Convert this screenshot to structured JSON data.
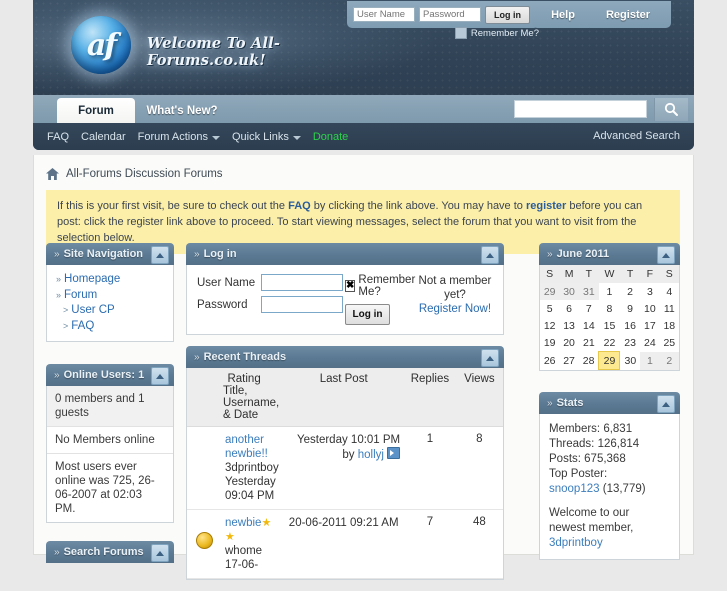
{
  "header": {
    "logo_text": "Welcome To All-Forums.co.uk!",
    "logo_mark": "af",
    "login": {
      "username_placeholder": "User Name",
      "password_placeholder": "Password",
      "username_value": "",
      "password_value": "",
      "login_label": "Log in",
      "remember_label": "Remember Me?"
    },
    "help_label": "Help",
    "register_label": "Register",
    "tabs": [
      {
        "label": "Forum",
        "active": true
      },
      {
        "label": "What's New?",
        "active": false
      }
    ],
    "search_value": "",
    "navlinks": [
      {
        "label": "FAQ",
        "caret": false,
        "donate": false
      },
      {
        "label": "Calendar",
        "caret": false,
        "donate": false
      },
      {
        "label": "Forum Actions",
        "caret": true,
        "donate": false
      },
      {
        "label": "Quick Links",
        "caret": true,
        "donate": false
      },
      {
        "label": "Donate",
        "caret": false,
        "donate": true
      }
    ],
    "advanced_search": "Advanced Search"
  },
  "breadcrumb": "All-Forums Discussion Forums",
  "notice": {
    "part1": "If this is your first visit, be sure to check out the ",
    "faq": "FAQ",
    "part2": " by clicking the link above. You may have to ",
    "register": "register",
    "part3": " before you can post: click the register link above to proceed. To start viewing messages, select the forum that you want to visit from the selection below."
  },
  "site_navigation": {
    "title": "Site Navigation",
    "items": [
      {
        "label": "Homepage",
        "marker": "»",
        "sub": false
      },
      {
        "label": "Forum",
        "marker": "»",
        "sub": false
      },
      {
        "label": "User CP",
        "marker": ">",
        "sub": true
      },
      {
        "label": "FAQ",
        "marker": ">",
        "sub": true
      }
    ]
  },
  "online_users": {
    "title": "Online Users: 1",
    "rows": [
      "0 members and 1 guests",
      "No Members online",
      "Most users ever online was 725, 26-06-2007 at 02:03 PM."
    ]
  },
  "search_forums": {
    "title": "Search Forums"
  },
  "login_block": {
    "title": "Log in",
    "username_label": "User Name",
    "password_label": "Password",
    "username_value": "",
    "password_value": "",
    "remember_label": "Remember Me?",
    "remember_checked": "✖",
    "login_label": "Log in",
    "not_member": "Not a member yet?",
    "register_now": "Register Now!"
  },
  "recent_threads": {
    "title": "Recent Threads",
    "columns": {
      "rating": "Rating",
      "title": "Title, Username, & Date",
      "last_post": "Last Post",
      "replies": "Replies",
      "views": "Views"
    },
    "rows": [
      {
        "icon": "",
        "title": "another newbie!!",
        "username": "3dprintboy",
        "date": "Yesterday 09:04 PM",
        "last_post_date": "Yesterday 10:01 PM",
        "last_post_by_prefix": "by",
        "last_post_by": "hollyj",
        "replies": "1",
        "views": "8",
        "stars": ""
      },
      {
        "icon": "coin",
        "title": "newbie",
        "username": "whome",
        "date": "17-06-",
        "last_post_date": "20-06-2011 09:21 AM",
        "last_post_by_prefix": "",
        "last_post_by": "",
        "replies": "7",
        "views": "48",
        "stars": "★ ★"
      }
    ]
  },
  "calendar": {
    "title": "June 2011",
    "daynames": [
      "S",
      "M",
      "T",
      "W",
      "T",
      "F",
      "S"
    ],
    "weeks": [
      [
        {
          "d": "29",
          "c": "off"
        },
        {
          "d": "30",
          "c": "off"
        },
        {
          "d": "31",
          "c": "off"
        },
        {
          "d": "1",
          "c": ""
        },
        {
          "d": "2",
          "c": ""
        },
        {
          "d": "3",
          "c": ""
        },
        {
          "d": "4",
          "c": ""
        }
      ],
      [
        {
          "d": "5",
          "c": ""
        },
        {
          "d": "6",
          "c": ""
        },
        {
          "d": "7",
          "c": ""
        },
        {
          "d": "8",
          "c": ""
        },
        {
          "d": "9",
          "c": ""
        },
        {
          "d": "10",
          "c": ""
        },
        {
          "d": "11",
          "c": ""
        }
      ],
      [
        {
          "d": "12",
          "c": ""
        },
        {
          "d": "13",
          "c": ""
        },
        {
          "d": "14",
          "c": ""
        },
        {
          "d": "15",
          "c": ""
        },
        {
          "d": "16",
          "c": ""
        },
        {
          "d": "17",
          "c": ""
        },
        {
          "d": "18",
          "c": ""
        }
      ],
      [
        {
          "d": "19",
          "c": ""
        },
        {
          "d": "20",
          "c": ""
        },
        {
          "d": "21",
          "c": ""
        },
        {
          "d": "22",
          "c": ""
        },
        {
          "d": "23",
          "c": ""
        },
        {
          "d": "24",
          "c": ""
        },
        {
          "d": "25",
          "c": ""
        }
      ],
      [
        {
          "d": "26",
          "c": ""
        },
        {
          "d": "27",
          "c": ""
        },
        {
          "d": "28",
          "c": ""
        },
        {
          "d": "29",
          "c": "today"
        },
        {
          "d": "30",
          "c": ""
        },
        {
          "d": "1",
          "c": "off"
        },
        {
          "d": "2",
          "c": "off"
        }
      ]
    ]
  },
  "stats": {
    "title": "Stats",
    "members": "Members: 6,831",
    "threads": "Threads: 126,814",
    "posts": "Posts: 675,368",
    "top_poster_label": "Top Poster:",
    "top_poster_name": "snoop123",
    "top_poster_count": "(13,779)",
    "welcome_line1": "Welcome to our",
    "welcome_line2": "newest member,",
    "newest_member": "3dprintboy"
  },
  "colors": {
    "header_dark": "#2f4154",
    "accent_blue": "#6d8ba3",
    "link": "#3c7ebd",
    "notice_bg": "#fcefa9",
    "donate_green": "#2bd34a",
    "today_bg": "#fde98f"
  }
}
